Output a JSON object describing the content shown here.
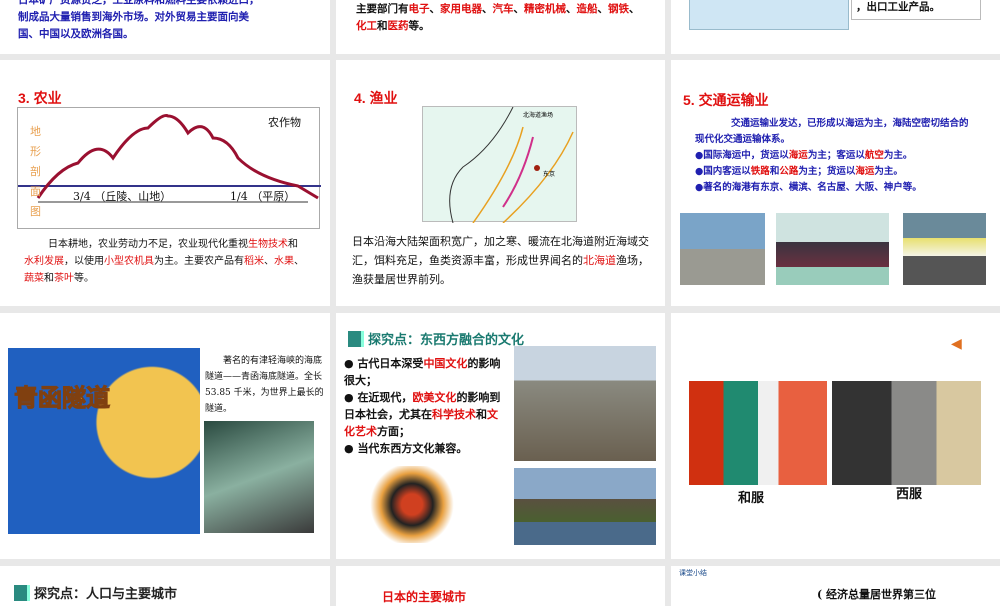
{
  "slides": {
    "s1_partial": {
      "line1": "日本矿产资源贫乏，工业原料和燃料主要依赖进口，",
      "line2": "制成品大量销售到海外市场。对外贸易主要面向美",
      "line3": "国、中国以及欧洲各国。"
    },
    "s2_partial": {
      "pre": "主要部门有",
      "items": [
        "电子",
        "家用电器",
        "汽车",
        "精密机械",
        "造船",
        "钢铁",
        "化工",
        "医药"
      ],
      "sep": "、",
      "and": "和",
      "end": "等。"
    },
    "s3_partial": {
      "box": "，出口工业产品。"
    },
    "agriculture": {
      "title": "3. 农业",
      "legend": "农作物",
      "side_label": "地形剖面图",
      "span1": "3/4 （丘陵、山地）",
      "span2": "1/4 （平原）",
      "t1": "日本耕地",
      "t2": "，农业劳动力不足，农业现代化重视",
      "h1": "生物技术",
      "and": "和",
      "h2": "水利发展",
      "t3": "，以使用",
      "h3": "小型农机具",
      "t4": "为主。主要农产品有",
      "h4": "稻米",
      "sep": "、",
      "h5": "水果",
      "h6": "蔬菜",
      "h7": "茶叶",
      "t5": "等。"
    },
    "fishery": {
      "title": "4. 渔业",
      "map_label": "北海道渔场",
      "city": "东京",
      "t1": "日本沿海大陆架面积宽广，加之寒、暖流在北海道附近海域交汇，饵料充足，鱼类资源丰富，形成世界闻名的",
      "h1": "北海道",
      "t2": "渔场，渔获量居世界前列。"
    },
    "transport": {
      "title": "5. 交通运输业",
      "p1": "交通运输业发达，已形成以海运为主，海陆空密切结合的现代化交通运输体系。",
      "b1a": "●国际海运中，货运以",
      "b1h1": "海运",
      "b1b": "为主；客运以",
      "b1h2": "航空",
      "b1c": "为主。",
      "b2a": "●国内客运以",
      "b2h1": "铁路",
      "b2b": "和",
      "b2h2": "公路",
      "b2c": "为主；货运以",
      "b2h3": "海运",
      "b2d": "为主。",
      "b3": "●著名的海港有东京、横滨、名古屋、大阪、神户等。"
    },
    "tunnel": {
      "map_title": "青函隧道",
      "text": "著名的有津轻海峡的海底隧道——青函海底隧道。全长 53.85 千米，为世界上最长的隧道。"
    },
    "culture": {
      "header": "探究点：东西方融合的文化",
      "b1a": "古代日本深受",
      "b1h": "中国文化",
      "b1b": "的影响很大；",
      "b2a": "在近现代，",
      "b2h": "欧美文化",
      "b2b": "的影响到日本社会，尤其在",
      "b2h2": "科学技术",
      "b2c": "和",
      "b2h3": "文化艺术",
      "b2d": "方面；",
      "b3": "当代东西方文化兼容。"
    },
    "clothing": {
      "label1": "和服",
      "label2": "西服"
    },
    "population": {
      "header": "探究点：人口与主要城市"
    },
    "cities": {
      "title": "日本的主要城市"
    },
    "summary": {
      "tag": "课堂小结",
      "line": "经济总量居世界第三位"
    }
  }
}
